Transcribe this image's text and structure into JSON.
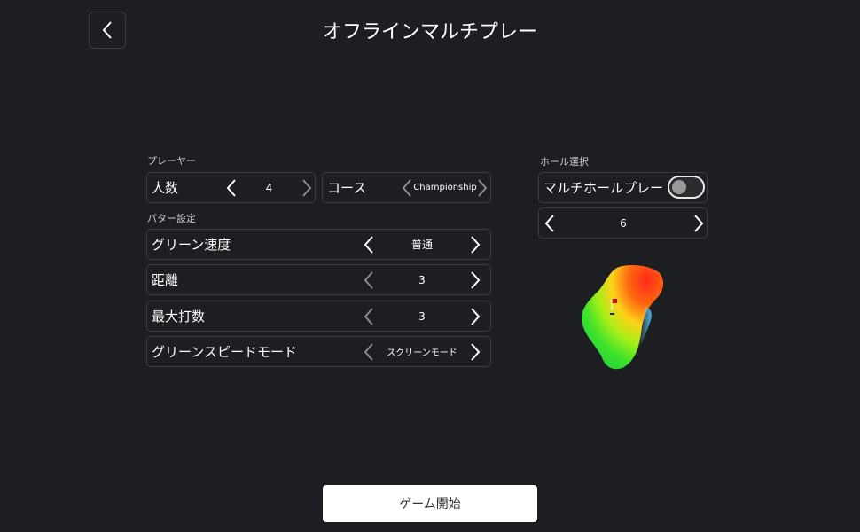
{
  "header": {
    "title": "オフラインマルチプレー"
  },
  "player_section": {
    "label": "プレーヤー",
    "count": {
      "label": "人数",
      "value": "4"
    },
    "course": {
      "label": "コース",
      "value": "Championship"
    }
  },
  "putter_section": {
    "label": "パター設定",
    "rows": [
      {
        "label": "グリーン速度",
        "value": "普通"
      },
      {
        "label": "距離",
        "value": "3"
      },
      {
        "label": "最大打数",
        "value": "3"
      },
      {
        "label": "グリーンスピードモード",
        "value": "スクリーンモード"
      }
    ]
  },
  "hole_section": {
    "label": "ホール選択",
    "multi_hole": {
      "label": "マルチホールプレー",
      "enabled": false
    },
    "hole_number": "6"
  },
  "start_button": {
    "label": "ゲーム開始"
  },
  "colors": {
    "background": "#1c1e21",
    "border": "#3a3d42",
    "dim_chevron": "#8a8d92"
  }
}
